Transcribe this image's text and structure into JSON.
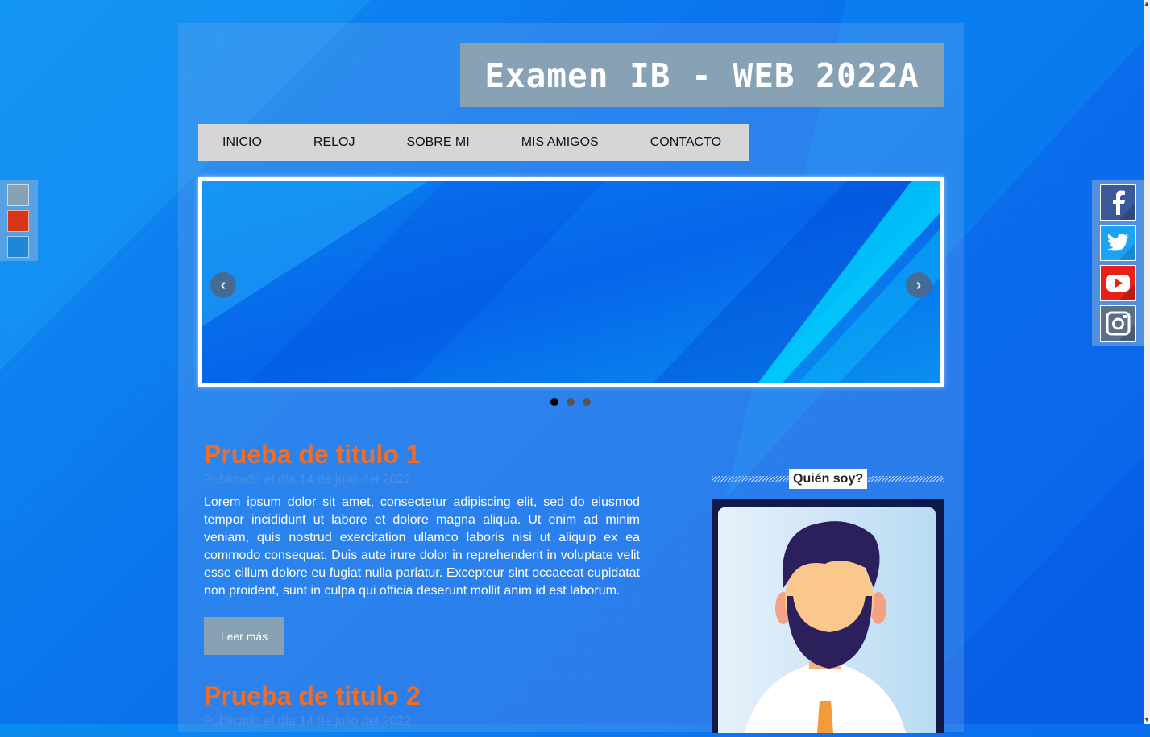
{
  "header": {
    "title": "Examen IB - WEB 2022A"
  },
  "nav": {
    "items": [
      {
        "label": "INICIO"
      },
      {
        "label": "RELOJ"
      },
      {
        "label": "SOBRE MI"
      },
      {
        "label": "MIS AMIGOS"
      },
      {
        "label": "CONTACTO"
      }
    ]
  },
  "slider": {
    "prev_icon": "chevron-left-icon",
    "next_icon": "chevron-right-icon",
    "prev_glyph": "‹",
    "next_glyph": "›",
    "slide_count": 3,
    "active_slide": 1
  },
  "posts": [
    {
      "title": "Prueba de titulo 1",
      "date": "Publicado el día 14 de julio del 2022",
      "body": "Lorem ipsum dolor sit amet, consectetur adipiscing elit, sed do eiusmod tempor incididunt ut labore et dolore magna aliqua. Ut enim ad minim veniam, quis nostrud exercitation ullamco laboris nisi ut aliquip ex ea commodo consequat. Duis aute irure dolor in reprehenderit in voluptate velit esse cillum dolore eu fugiat nulla pariatur. Excepteur sint occaecat cupidatat non proident, sunt in culpa qui officia deserunt mollit anim id est laborum.",
      "read_more": "Leer más"
    },
    {
      "title": "Prueba de titulo 2",
      "date": "Publicado el día 14 de julio del 2022"
    }
  ],
  "sidebar": {
    "heading": "Quién soy?",
    "avatar_icon": "user-avatar-icon"
  },
  "color_switcher": {
    "swatches": [
      "#86a2b4",
      "#d63516",
      "#1e88d6"
    ]
  },
  "social": {
    "items": [
      {
        "icon": "facebook-icon",
        "color": "#3b5998"
      },
      {
        "icon": "twitter-icon",
        "color": "#1da1f2"
      },
      {
        "icon": "youtube-icon",
        "color": "#e62117"
      },
      {
        "icon": "instagram-icon",
        "color": "#5b6f88"
      }
    ]
  },
  "colors": {
    "accent_title": "#f36c20",
    "header_bg": "#86a2b4",
    "nav_bg": "#d6d6d6"
  }
}
